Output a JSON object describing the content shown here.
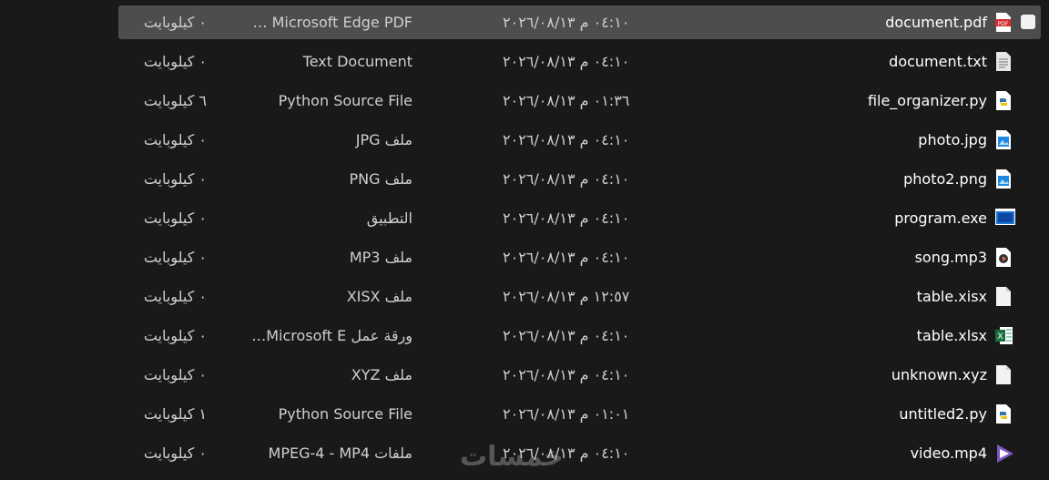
{
  "files": [
    {
      "name": "document.pdf",
      "date": "٠٤:١٠ م ٢٠٢٦/٠٨/١٣",
      "type": "Microsoft Edge PDF …",
      "size": "٠ كيلوبايت",
      "icon": "pdf-icon",
      "selected": true
    },
    {
      "name": "document.txt",
      "date": "٠٤:١٠ م ٢٠٢٦/٠٨/١٣",
      "type": "Text Document",
      "size": "٠ كيلوبايت",
      "icon": "text-doc-icon"
    },
    {
      "name": "file_organizer.py",
      "date": "٠١:٣٦ م ٢٠٢٦/٠٨/١٣",
      "type": "Python Source File",
      "size": "٦ كيلوبايت",
      "icon": "python-file-icon"
    },
    {
      "name": "photo.jpg",
      "date": "٠٤:١٠ م ٢٠٢٦/٠٨/١٣",
      "type": "ملف JPG",
      "size": "٠ كيلوبايت",
      "icon": "image-file-icon"
    },
    {
      "name": "photo2.png",
      "date": "٠٤:١٠ م ٢٠٢٦/٠٨/١٣",
      "type": "ملف PNG",
      "size": "٠ كيلوبايت",
      "icon": "image-file-icon"
    },
    {
      "name": "program.exe",
      "date": "٠٤:١٠ م ٢٠٢٦/٠٨/١٣",
      "type": "التطبيق",
      "size": "٠ كيلوبايت",
      "icon": "exe-icon"
    },
    {
      "name": "song.mp3",
      "date": "٠٤:١٠ م ٢٠٢٦/٠٨/١٣",
      "type": "ملف MP3",
      "size": "٠ كيلوبايت",
      "icon": "audio-file-icon"
    },
    {
      "name": "table.xisx",
      "date": "١٢:٥٧ م ٢٠٢٦/٠٨/١٣",
      "type": "ملف XISX",
      "size": "٠ كيلوبايت",
      "icon": "blank-file-icon"
    },
    {
      "name": "table.xlsx",
      "date": "٠٤:١٠ م ٢٠٢٦/٠٨/١٣",
      "type": "ورقة عمل Microsoft E…",
      "size": "٠ كيلوبايت",
      "icon": "excel-icon"
    },
    {
      "name": "unknown.xyz",
      "date": "٠٤:١٠ م ٢٠٢٦/٠٨/١٣",
      "type": "ملف XYZ",
      "size": "٠ كيلوبايت",
      "icon": "blank-file-icon"
    },
    {
      "name": "untitled2.py",
      "date": "٠١:٠١ م ٢٠٢٦/٠٨/١٣",
      "type": "Python Source File",
      "size": "١ كيلوبايت",
      "icon": "python-file-icon"
    },
    {
      "name": "video.mp4",
      "date": "٠٤:١٠ م ٢٠٢٦/٠٨/١٣",
      "type": "ملفات MPEG-4 - MP4",
      "size": "٠ كيلوبايت",
      "icon": "video-file-icon"
    }
  ],
  "watermark": "خمسات",
  "colors": {
    "background": "#191919",
    "selected_row": "#4d4d4d",
    "text": "#ffffff",
    "muted_text": "#cfcfcf"
  }
}
